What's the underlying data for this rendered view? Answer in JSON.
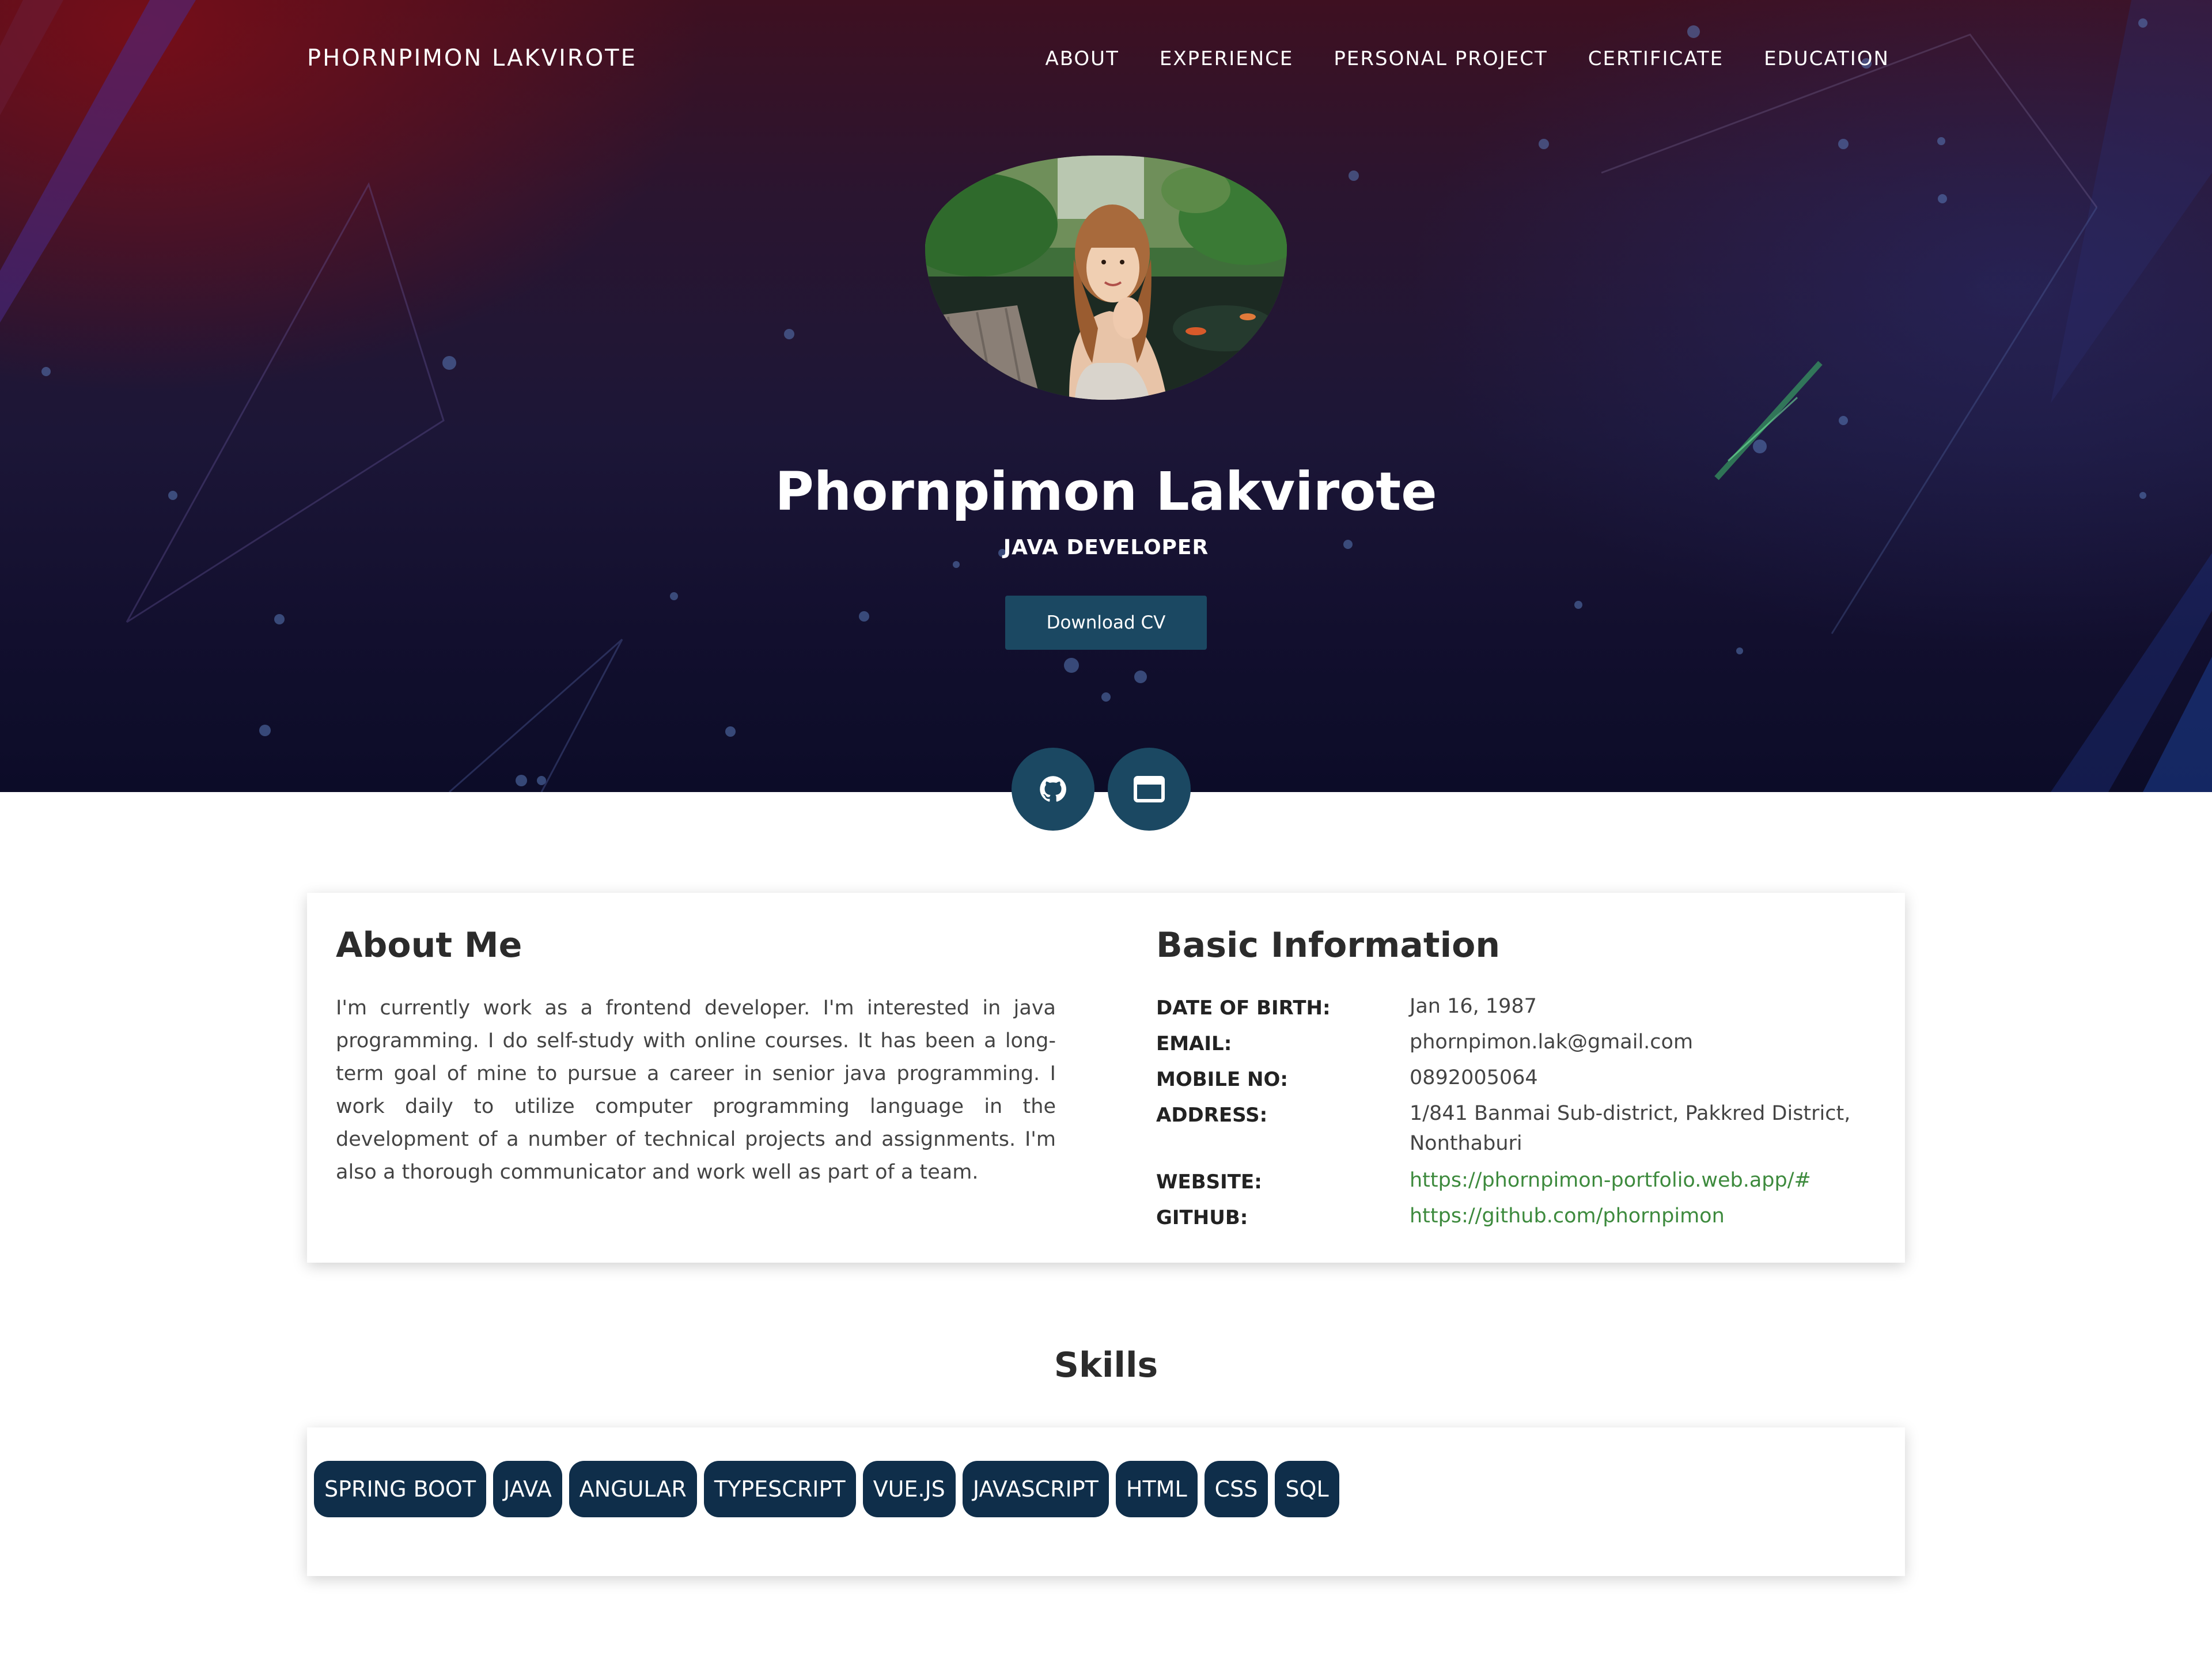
{
  "brand": "PHORNPIMON LAKVIROTE",
  "nav": [
    "ABOUT",
    "EXPERIENCE",
    "PERSONAL PROJECT",
    "CERTIFICATE",
    "EDUCATION"
  ],
  "hero": {
    "name": "Phornpimon Lakvirote",
    "role": "JAVA DEVELOPER",
    "cv_button": "Download CV"
  },
  "social": [
    {
      "icon": "github-icon"
    },
    {
      "icon": "browser-window-icon"
    }
  ],
  "about": {
    "title": "About Me",
    "text": "I'm currently work as a frontend developer. I'm interested in java programming. I do self-study with online courses. It has been a long-term goal of mine to pursue a career in senior java programming. I work daily to utilize computer programming language in the development of a number of technical projects and assignments. I'm also a thorough communicator and work well as part of a team."
  },
  "basic_info": {
    "title": "Basic Information",
    "rows": [
      {
        "label": "DATE OF BIRTH:",
        "value": "Jan 16, 1987"
      },
      {
        "label": "EMAIL:",
        "value": "phornpimon.lak@gmail.com"
      },
      {
        "label": "MOBILE NO:",
        "value": "0892005064"
      },
      {
        "label": "ADDRESS:",
        "value": "1/841 Banmai Sub-district, Pakkred District, Nonthaburi"
      },
      {
        "label": "WEBSITE:",
        "value": "https://phornpimon-portfolio.web.app/#"
      },
      {
        "label": "GITHUB:",
        "value": "https://github.com/phornpimon"
      }
    ]
  },
  "skills": {
    "title": "Skills",
    "items": [
      "SPRING BOOT",
      "JAVA",
      "ANGULAR",
      "TYPESCRIPT",
      "VUE.JS",
      "JAVASCRIPT",
      "HTML",
      "CSS",
      "SQL"
    ]
  },
  "colors": {
    "accent": "#1b4862",
    "chip": "#0f2e4a",
    "link": "#3d8a3d"
  }
}
